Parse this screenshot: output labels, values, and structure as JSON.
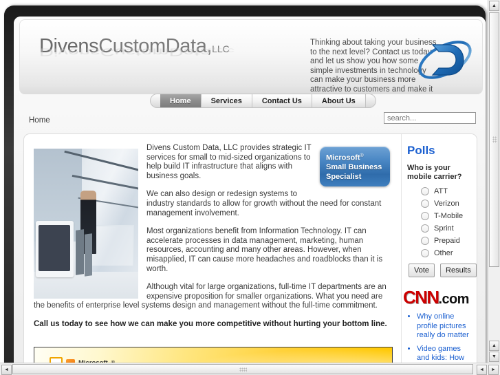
{
  "site": {
    "logo": {
      "bold_part": "Divens",
      "regular_part": "CustomData,",
      "suffix": "LLC"
    },
    "tagline": "Thinking about taking your business to the next level?  Contact us today and let us show you how some simple investments in technology can make your business more attractive to customers and make it",
    "emblem_icon": "divens-d-orbit-logo",
    "emblem_color": "#1f6bb5"
  },
  "nav": {
    "items": [
      {
        "label": "Home",
        "active": true
      },
      {
        "label": "Services",
        "active": false
      },
      {
        "label": "Contact Us",
        "active": false
      },
      {
        "label": "About Us",
        "active": false
      }
    ]
  },
  "breadcrumb": {
    "text": "Home"
  },
  "search": {
    "value": "",
    "placeholder": "search..."
  },
  "main": {
    "photo_alt": "office-walkway-photo",
    "paragraphs": [
      "Divens Custom Data, LLC provides strategic IT services for small to mid-sized organizations to help build IT infrastructure that aligns with business goals.",
      "We can also design or redesign systems to industry standards to allow for growth without the need for constant management involvement.",
      "Most organizations benefit from Information Technology. IT can accelerate processes in data management, marketing, human resources, accounting and many other areas. However, when misapplied, IT can cause more headaches and roadblocks than it is worth.",
      "Although vital for large organizations, full-time IT departments are an expensive proposition for smaller organizations. What you need are the benefits of enterprise level systems design and management without the full-time commitment."
    ],
    "call_to_action": "Call us today to see how we can make you more competitive without hurting your bottom line.",
    "badge": {
      "line1": "Microsoft",
      "registered": "®",
      "line2": "Small Business",
      "line3": "Specialist",
      "color": "#2f6cab"
    },
    "promo": {
      "label": "Microsoft",
      "registered": "®",
      "icon": "windows-flag-icon"
    }
  },
  "sidebar": {
    "polls": {
      "title": "Polls",
      "title_color": "#1a5fd0",
      "question": "Who is your mobile carrier?",
      "options": [
        "ATT",
        "Verizon",
        "T-Mobile",
        "Sprint",
        "Prepaid",
        "Other"
      ],
      "vote_label": "Vote",
      "results_label": "Results"
    },
    "cnn": {
      "logo_main": "CNN",
      "logo_suffix": ".com",
      "logo_color": "#cc0000",
      "headlines": [
        "Why online profile pictures really do matter",
        "Video games and kids: How young is"
      ]
    }
  },
  "scrollbars": {
    "up_arrow": "▲",
    "down_arrow": "▼",
    "left_arrow": "◄",
    "right_arrow": "►"
  }
}
